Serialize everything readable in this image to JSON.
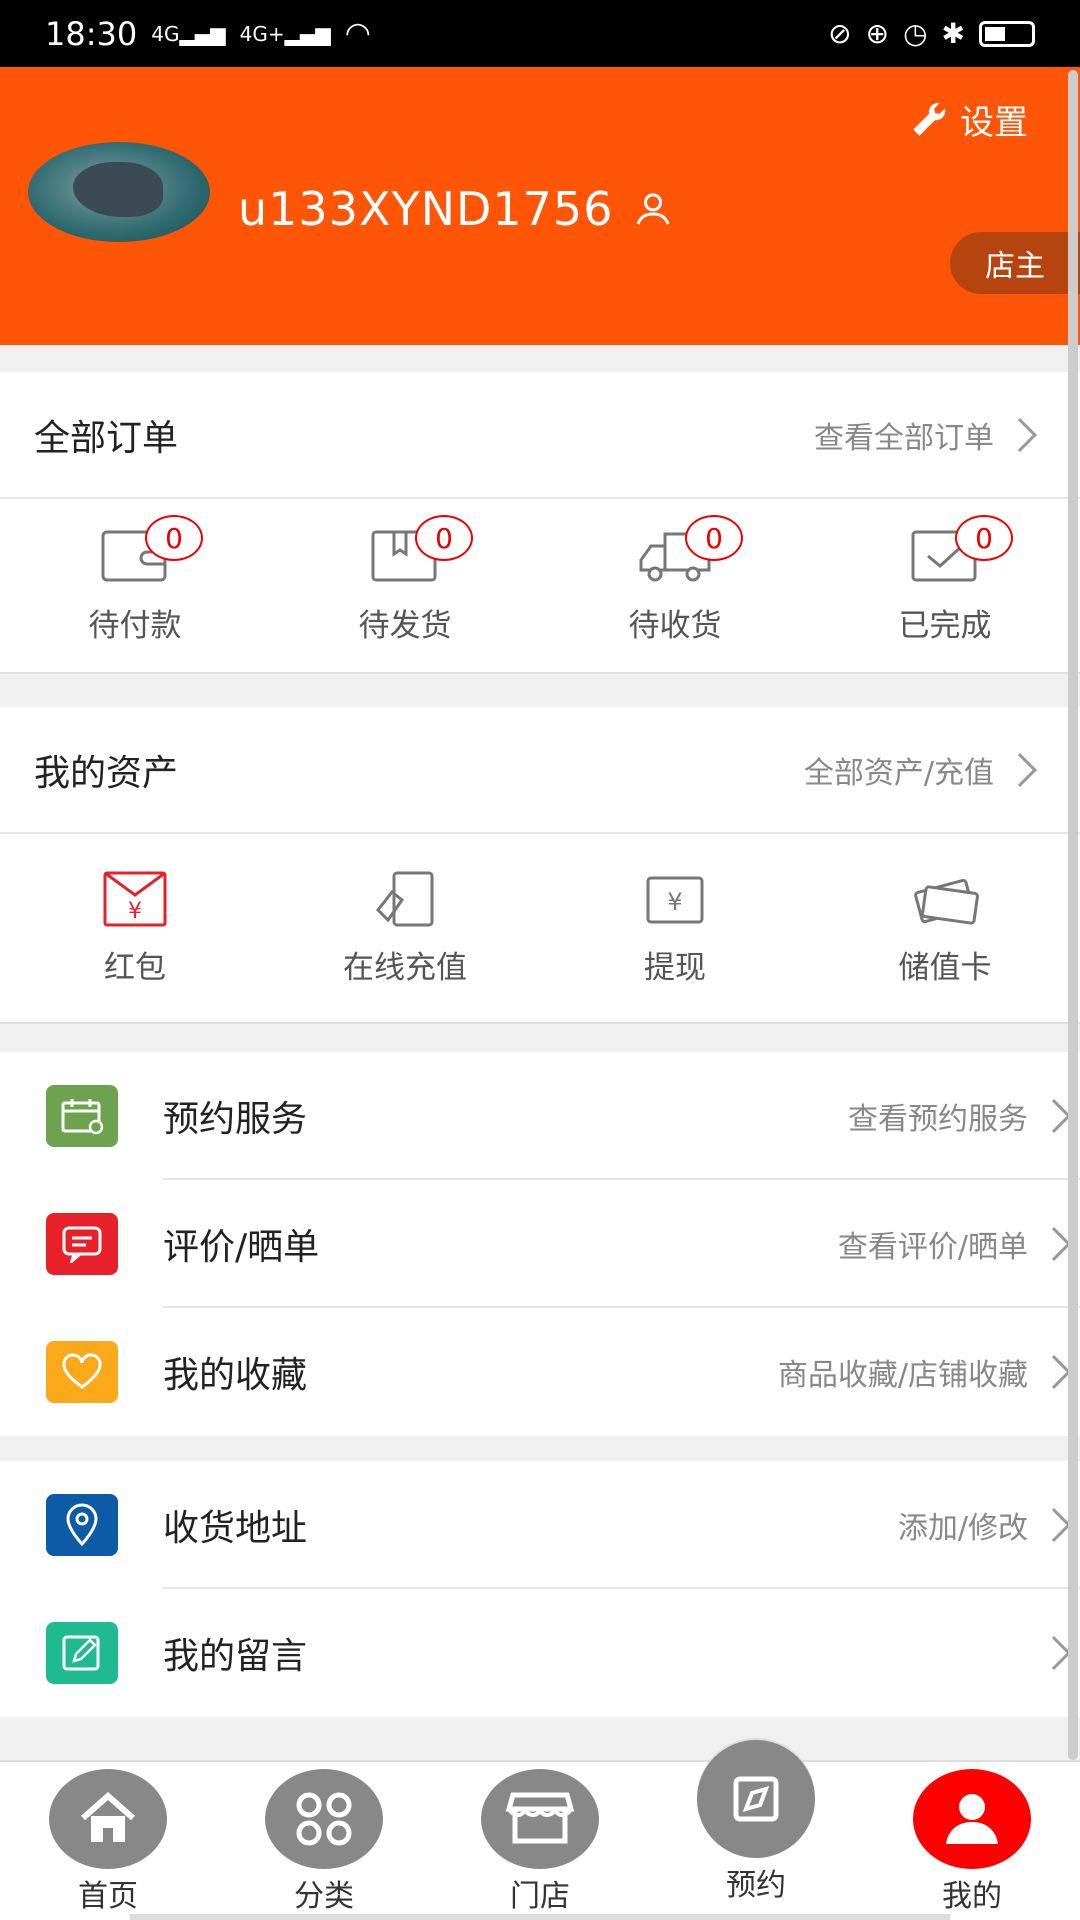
{
  "status_bar": {
    "time": "18:30",
    "signal1": "4G",
    "signal2": "4G+"
  },
  "header": {
    "settings_label": "设置",
    "username": "u133XYND1756",
    "role_badge": "店主",
    "accent": "#ff5506"
  },
  "orders": {
    "title": "全部订单",
    "link": "查看全部订单",
    "items": [
      {
        "label": "待付款",
        "count": "0",
        "icon": "wallet-icon"
      },
      {
        "label": "待发货",
        "count": "0",
        "icon": "package-icon"
      },
      {
        "label": "待收货",
        "count": "0",
        "icon": "truck-icon"
      },
      {
        "label": "已完成",
        "count": "0",
        "icon": "check-box-icon"
      }
    ]
  },
  "assets": {
    "title": "我的资产",
    "link": "全部资产/充值",
    "items": [
      {
        "label": "红包",
        "icon": "red-envelope-icon"
      },
      {
        "label": "在线充值",
        "icon": "recharge-icon"
      },
      {
        "label": "提现",
        "icon": "withdraw-icon"
      },
      {
        "label": "储值卡",
        "icon": "stored-value-card-icon"
      }
    ]
  },
  "menu1": [
    {
      "label": "预约服务",
      "link": "查看预约服务",
      "icon": "calendar-icon",
      "color": "#6da24e"
    },
    {
      "label": "评价/晒单",
      "link": "查看评价/晒单",
      "icon": "comment-icon",
      "color": "#e8202a"
    },
    {
      "label": "我的收藏",
      "link": "商品收藏/店铺收藏",
      "icon": "heart-icon",
      "color": "#f9a91a"
    }
  ],
  "menu2": [
    {
      "label": "收货地址",
      "link": "添加/修改",
      "icon": "location-icon",
      "color": "#0d5aa7"
    },
    {
      "label": "我的留言",
      "link": "",
      "icon": "edit-icon",
      "color": "#1fba8f"
    }
  ],
  "tabs": [
    {
      "label": "首页",
      "icon": "home-icon"
    },
    {
      "label": "分类",
      "icon": "category-icon"
    },
    {
      "label": "门店",
      "icon": "store-icon"
    },
    {
      "label": "预约",
      "icon": "compass-icon"
    },
    {
      "label": "我的",
      "icon": "user-icon"
    }
  ]
}
